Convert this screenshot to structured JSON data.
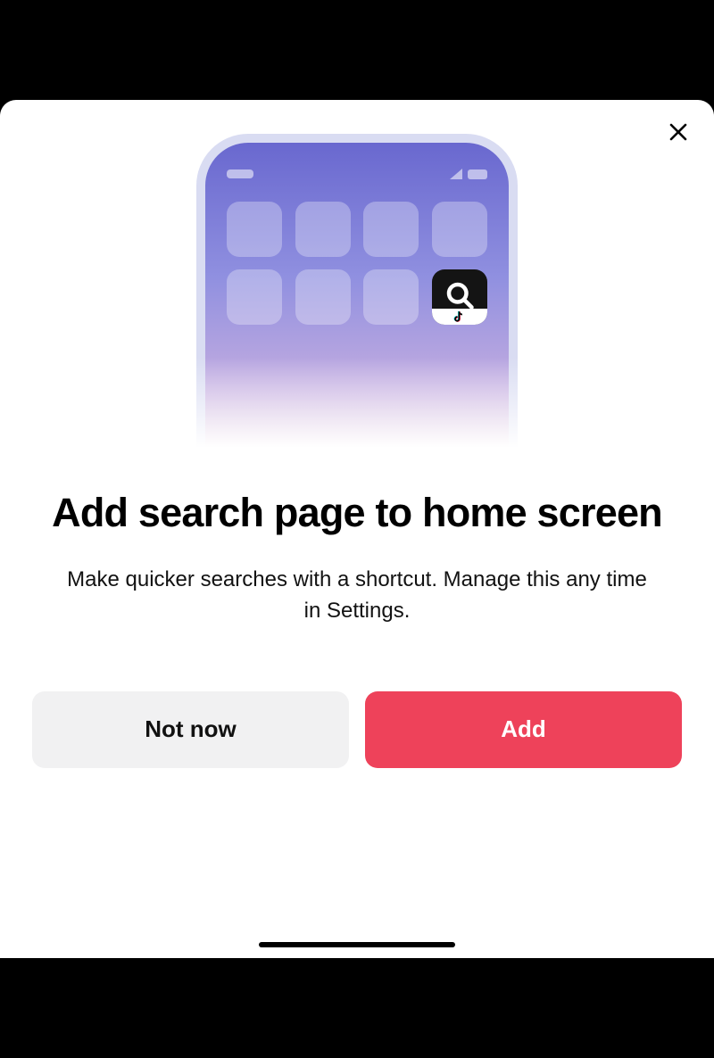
{
  "modal": {
    "title": "Add search page to home screen",
    "subtitle": "Make quicker searches with a shortcut. Manage this any time in Settings.",
    "buttons": {
      "secondary": "Not now",
      "primary": "Add"
    }
  },
  "illustration": {
    "search_icon": "search-icon",
    "tiktok_icon": "tiktok-icon"
  },
  "colors": {
    "primary_button": "#ee425a",
    "secondary_button": "#f1f1f2"
  }
}
